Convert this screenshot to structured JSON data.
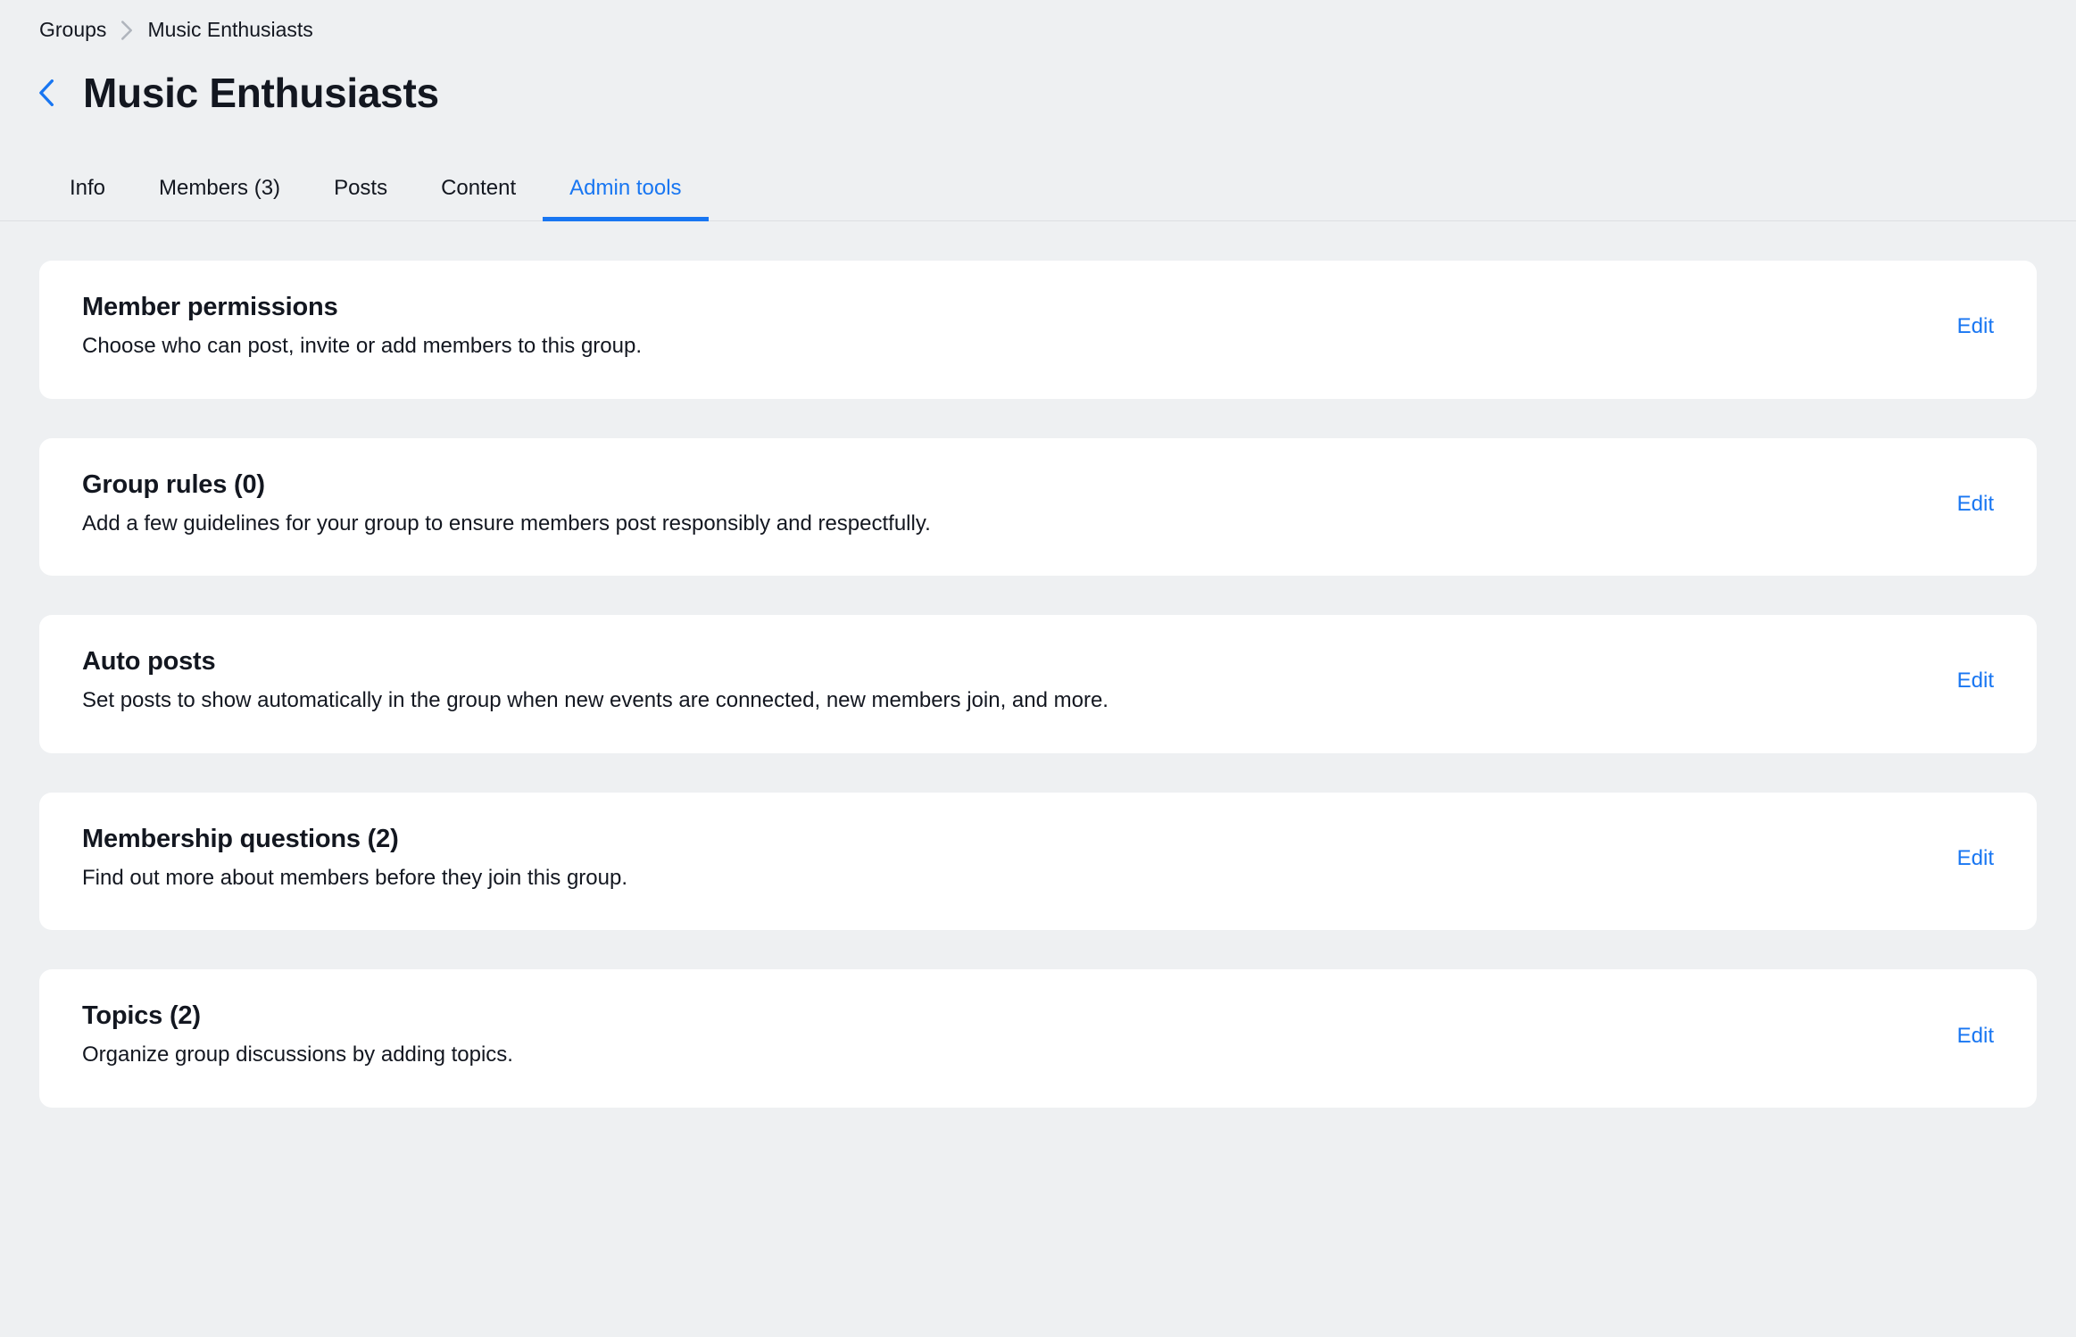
{
  "breadcrumb": {
    "root": "Groups",
    "current": "Music Enthusiasts"
  },
  "page": {
    "title": "Music Enthusiasts"
  },
  "tabs": {
    "info": "Info",
    "members": "Members (3)",
    "posts": "Posts",
    "content": "Content",
    "admin_tools": "Admin tools"
  },
  "cards": {
    "member_permissions": {
      "title": "Member permissions",
      "description": "Choose who can post, invite or add members to this group.",
      "action": "Edit"
    },
    "group_rules": {
      "title": "Group rules (0)",
      "description": "Add a few guidelines for your group to ensure members post responsibly and respectfully.",
      "action": "Edit"
    },
    "auto_posts": {
      "title": "Auto posts",
      "description": "Set posts to show automatically in the group when new events are connected, new members join, and more.",
      "action": "Edit"
    },
    "membership_questions": {
      "title": "Membership questions (2)",
      "description": "Find out more about members before they join this group.",
      "action": "Edit"
    },
    "topics": {
      "title": "Topics (2)",
      "description": "Organize group discussions by adding topics.",
      "action": "Edit"
    }
  }
}
